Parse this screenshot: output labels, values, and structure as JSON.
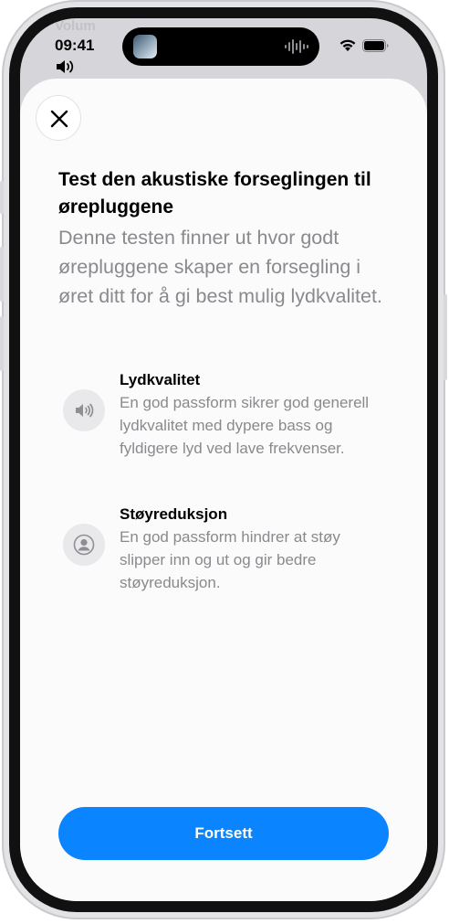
{
  "status_bar": {
    "background_label": "Volum",
    "time": "09:41"
  },
  "sheet": {
    "title": "Test den akustiske forseglingen til ørepluggene",
    "description": "Denne testen finner ut hvor godt ørepluggene skaper en forsegling i øret ditt for å gi best mulig lydkvalitet.",
    "features": [
      {
        "icon": "speaker-icon",
        "title": "Lydkvalitet",
        "description": "En god passform sikrer god generell lydkvalitet med dypere bass og fyldigere lyd ved lave frekvenser."
      },
      {
        "icon": "person-icon",
        "title": "Støyreduksjon",
        "description": "En god passform hindrer at støy slipper inn og ut og gir bedre støyreduksjon."
      }
    ],
    "continue_label": "Fortsett"
  },
  "colors": {
    "accent": "#0a84ff",
    "secondary_text": "#8a8a8e",
    "icon_background": "#e9e9ec"
  }
}
